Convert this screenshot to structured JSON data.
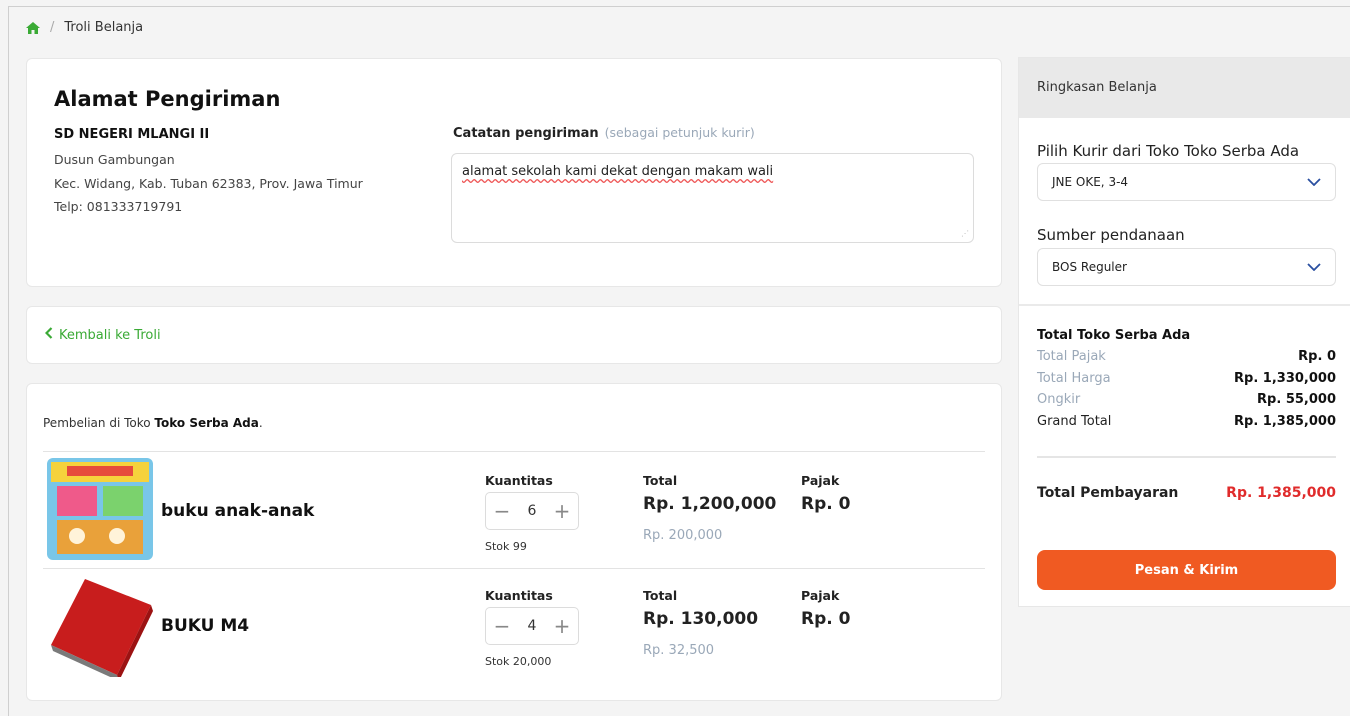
{
  "breadcrumb": {
    "home_icon": "home-icon",
    "separator": "/",
    "current": "Troli Belanja"
  },
  "address": {
    "title": "Alamat Pengiriman",
    "name": "SD NEGERI MLANGI II",
    "line1": "Dusun Gambungan",
    "line2": "Kec. Widang, Kab. Tuban 62383, Prov. Jawa Timur",
    "phone": "Telp: 081333719791",
    "note_label": "Catatan pengiriman",
    "note_hint": "(sebagai petunjuk kurir)",
    "note_value": "alamat sekolah kami dekat dengan makam wali"
  },
  "back": {
    "label": "Kembali ke Troli"
  },
  "items_section": {
    "store_prefix": "Pembelian di Toko ",
    "store_name": "Toko Serba Ada",
    "store_suffix": ".",
    "qty_label": "Kuantitas",
    "total_label": "Total",
    "tax_label": "Pajak",
    "items": [
      {
        "name": "buku anak-anak",
        "qty": "6",
        "stock": "Stok 99",
        "total": "Rp. 1,200,000",
        "unit_price": "Rp. 200,000",
        "tax": "Rp. 0"
      },
      {
        "name": "BUKU M4",
        "qty": "4",
        "stock": "Stok 20,000",
        "total": "Rp. 130,000",
        "unit_price": "Rp. 32,500",
        "tax": "Rp. 0"
      }
    ]
  },
  "summary": {
    "header": "Ringkasan Belanja",
    "courier_label": "Pilih Kurir dari Toko Toko Serba Ada",
    "courier_value": "JNE OKE, 3-4",
    "funding_label": "Sumber pendanaan",
    "funding_value": "BOS Reguler",
    "store_total_title": "Total Toko Serba Ada",
    "tax_label": "Total Pajak",
    "tax_value": "Rp. 0",
    "price_label": "Total Harga",
    "price_value": "Rp. 1,330,000",
    "shipping_label": "Ongkir",
    "shipping_value": "Rp. 55,000",
    "grand_label": "Grand Total",
    "grand_value": "Rp. 1,385,000",
    "payment_label": "Total Pembayaran",
    "payment_value": "Rp. 1,385,000",
    "order_button": "Pesan & Kirim"
  },
  "colors": {
    "accent_green": "#3aaa35",
    "order_button": "#f05a22",
    "payment_red": "#e02b2b",
    "muted": "#9aa8b8"
  }
}
